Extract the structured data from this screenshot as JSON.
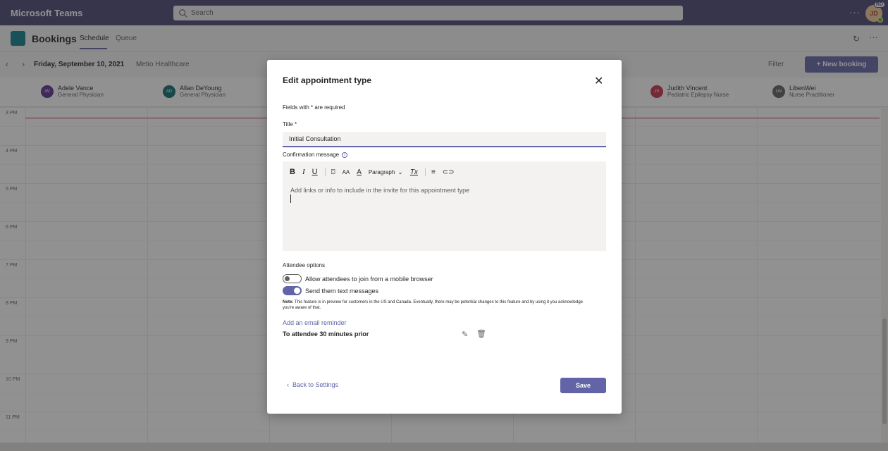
{
  "titlebar": {
    "app_title": "Microsoft Teams",
    "search_placeholder": "Search",
    "more": "···",
    "avatar_initials": "JD",
    "avatar_badge": "RD"
  },
  "appbar": {
    "app_name": "Bookings",
    "tabs": [
      {
        "label": "Schedule"
      },
      {
        "label": "Queue"
      }
    ],
    "more": "···"
  },
  "toolbar": {
    "date": "Friday, September 10, 2021",
    "business": "Metio Healthcare",
    "filter": "Filter",
    "new_booking": "+ New booking"
  },
  "staff": [
    {
      "initials": "AV",
      "name": "Adele Vance",
      "role": "General Physician",
      "color": "#5c2e91"
    },
    {
      "initials": "AD",
      "name": "Allan DeYoung",
      "role": "General Physician",
      "color": "#0b6a6f"
    },
    {
      "initials": "JV",
      "name": "Judith Vincent",
      "role": "Pediatric Epilepsy Nurse",
      "color": "#c4314b"
    },
    {
      "initials": "LW",
      "name": "LibenWei",
      "role": "Nurse Practitioner",
      "color": "#605e5c"
    }
  ],
  "times": [
    "3 PM",
    "4 PM",
    "5 PM",
    "6 PM",
    "7 PM",
    "8 PM",
    "9 PM",
    "10 PM",
    "11 PM"
  ],
  "dialog": {
    "title": "Edit appointment type",
    "required_note": "Fields with * are required",
    "title_label": "Title *",
    "title_value": "Initial Consultation",
    "confirmation_label": "Confirmation message",
    "paragraph": "Paragraph",
    "editor_placeholder": "Add links or info to include in the invite for this appointment type",
    "attendee_options": "Attendee options",
    "toggle_mobile": "Allow attendees to join from a mobile browser",
    "toggle_sms": "Send them text messages",
    "note_label": "Note:",
    "note_text": " This feature is in preview for customers in the US and Canada. Eventually, there may be potential changes to this feature and by using it you acknowledge you're aware of that.",
    "add_email_reminder": "Add an email reminder",
    "reminder": "To attendee 30 minutes prior",
    "back": "Back to Settings",
    "save": "Save"
  }
}
